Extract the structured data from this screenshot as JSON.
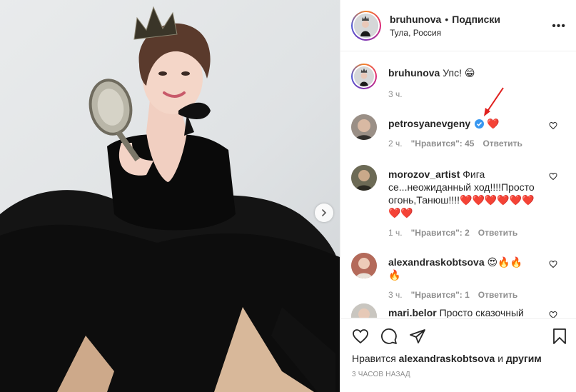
{
  "post": {
    "author": "bruhunova",
    "separator": "•",
    "follow_label": "Подписки",
    "location": "Тула, Россия",
    "more_label": "•••"
  },
  "caption": {
    "username": "bruhunova",
    "text": "Упс! 😁",
    "time": "3 ч."
  },
  "comments": [
    {
      "username": "petrosyanevgeny",
      "text": "❤️",
      "time": "2 ч.",
      "likes": "\"Нравится\": 45",
      "reply": "Ответить",
      "verified": true
    },
    {
      "username": "morozov_artist",
      "text": "Фига се...неожиданный ход!!!!Просто огонь,Танюш!!!!❤️❤️❤️❤️❤️❤️❤️❤️",
      "time": "1 ч.",
      "likes": "\"Нравится\": 2",
      "reply": "Ответить"
    },
    {
      "username": "alexandraskobtsova",
      "text": "😍🔥🔥🔥",
      "time": "3 ч.",
      "likes": "\"Нравится\": 1",
      "reply": "Ответить"
    },
    {
      "username": "mari.belor",
      "text": "Просто сказочный"
    }
  ],
  "footer": {
    "likes_prefix": "Нравится",
    "likes_user": "alexandraskobtsova",
    "likes_and": "и",
    "likes_others": "другим",
    "timestamp": "3 ЧАСОВ НАЗАД"
  },
  "colors": {
    "text": "#262626",
    "muted": "#8e8e8e",
    "verified": "#3897f0",
    "heart": "#ed4956",
    "annotation_arrow": "#e0201e"
  },
  "icons": [
    "heart-icon",
    "comment-icon",
    "share-icon",
    "bookmark-icon",
    "chevron-right-icon",
    "verified-icon"
  ]
}
